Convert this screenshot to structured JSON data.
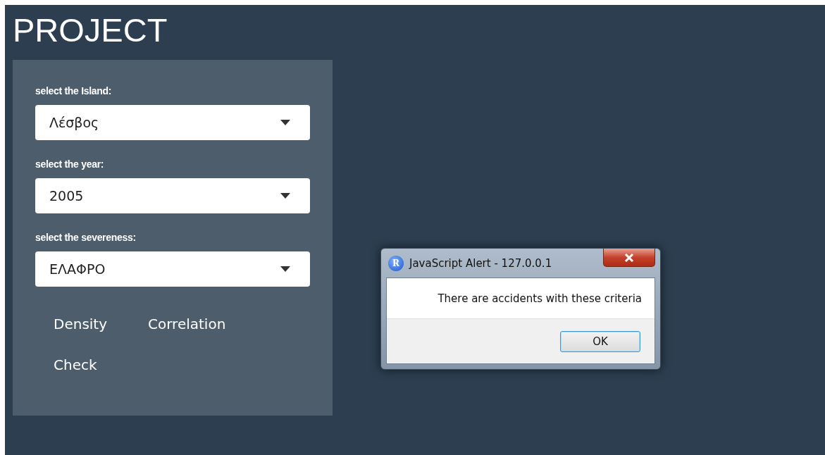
{
  "title": "PROJECT",
  "inputs": [
    {
      "label": "select the Island:",
      "value": "Λέσβος"
    },
    {
      "label": "select the year:",
      "value": "2005"
    },
    {
      "label": "select the severeness:",
      "value": "ΕΛΑΦΡΟ"
    }
  ],
  "links": [
    {
      "label": "Density"
    },
    {
      "label": "Correlation"
    },
    {
      "label": "Check"
    }
  ],
  "alert": {
    "title": "JavaScript Alert - 127.0.0.1",
    "icon_letter": "R",
    "message": "There are accidents with these criteria",
    "buttons": [
      "OK"
    ]
  }
}
